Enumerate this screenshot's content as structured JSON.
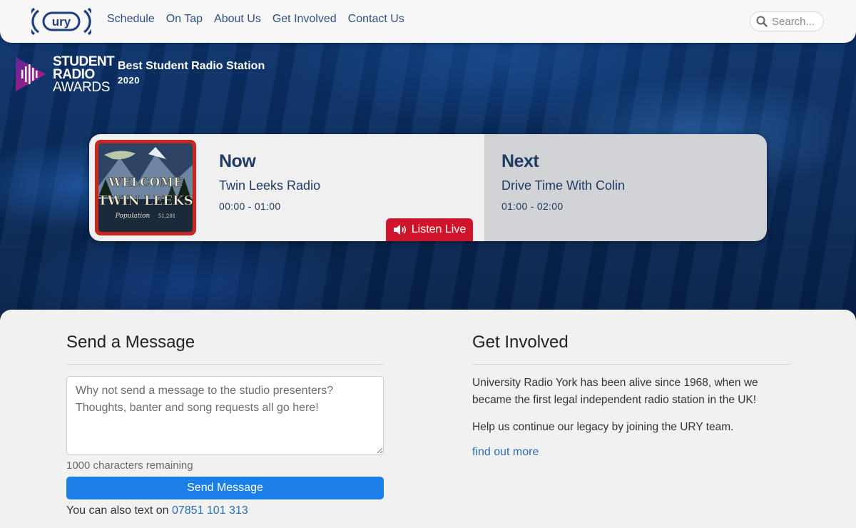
{
  "nav": {
    "logo_text": "ury",
    "links": [
      "Schedule",
      "On Tap",
      "About Us",
      "Get Involved",
      "Contact Us"
    ],
    "search_placeholder": "Search..."
  },
  "award": {
    "logo_line1": "STUDENT",
    "logo_line2": "RADIO",
    "logo_line3": "AWARDS",
    "title": "Best Student Radio Station",
    "year": "2020"
  },
  "now_next": {
    "now": {
      "label": "Now",
      "show": "Twin Leeks Radio",
      "time": "00:00 - 01:00",
      "image_text_line1": "WELCOME",
      "image_text_line2": "TWIN LEEKS",
      "image_text_line3": "Population",
      "image_text_line4": "51,201"
    },
    "next": {
      "label": "Next",
      "show": "Drive Time With Colin",
      "time": "01:00 - 02:00"
    },
    "listen_label": "Listen Live"
  },
  "message": {
    "title": "Send a Message",
    "placeholder": "Why not send a message to the studio presenters? Thoughts, banter and song requests all go here!",
    "chars_remaining": "1000 characters remaining",
    "send_label": "Send Message",
    "text_prefix": "You can also text on",
    "phone": "07851 101 313"
  },
  "get_involved": {
    "title": "Get Involved",
    "paragraph1": "University Radio York has been alive since 1968, when we became the first legal independent radio station in the UK!",
    "paragraph2": "Help us continue our legacy by joining the URY team.",
    "link": "find out more"
  },
  "colors": {
    "nav_link": "#2f4f86",
    "listen_live": "#d0142b",
    "send_button": "#1a80e8",
    "link": "#2b6cb5",
    "hero": "#0a2d60"
  }
}
